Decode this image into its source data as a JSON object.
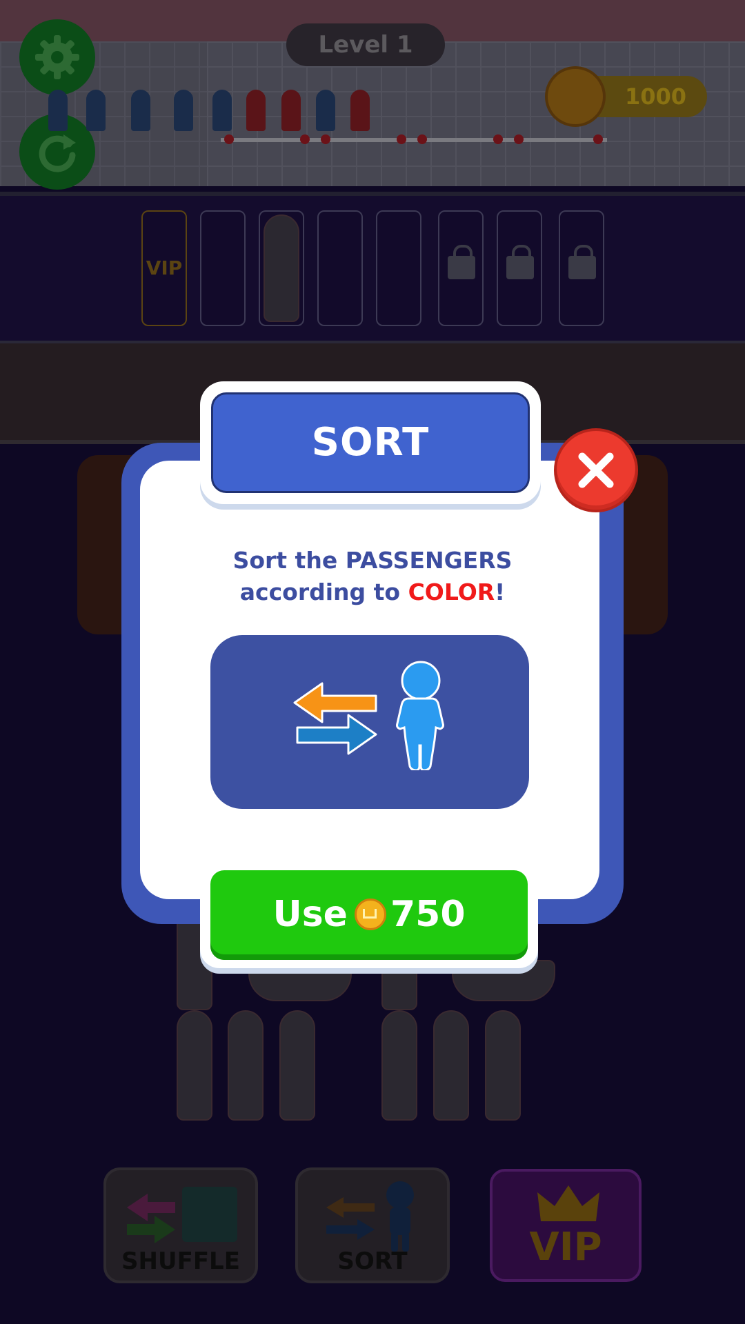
{
  "hud": {
    "level_label": "Level 1",
    "coins": "1000",
    "settings_icon": "gear-icon",
    "restart_icon": "restart-icon"
  },
  "dock": {
    "vip_slot_label": "VIP",
    "locked_slots": 3
  },
  "tools": {
    "shuffle_label": "SHUFFLE",
    "sort_label": "SORT",
    "vip_label": "VIP"
  },
  "modal": {
    "title": "SORT",
    "desc_line1": "Sort the PASSENGERS",
    "desc_line2_prefix": "according to ",
    "desc_line2_highlight": "COLOR",
    "desc_line2_suffix": "!",
    "use_label": "Use",
    "use_price": "750",
    "close_icon": "close-icon"
  },
  "colors": {
    "panel_blue": "#3e57b7",
    "title_blue": "#4063cf",
    "use_green": "#1fc90e",
    "close_red": "#ec3a2e",
    "highlight_red": "#f01a1a",
    "text_blue": "#3c4da0"
  }
}
